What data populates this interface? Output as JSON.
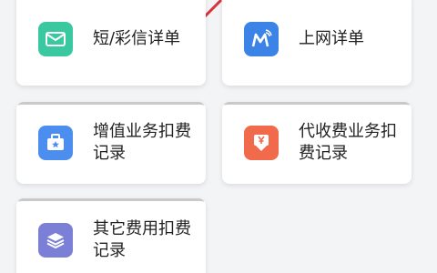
{
  "colors": {
    "sms_icon_bg": "#39c8a0",
    "data_icon_bg": "#3b83e6",
    "vas_icon_bg": "#4b8ef0",
    "proxy_icon_bg": "#f06a4b",
    "other_icon_bg": "#7b7fd6",
    "accent_stroke": "#d9323a"
  },
  "cards": [
    {
      "label": "短/彩信详单",
      "icon": "envelope-icon"
    },
    {
      "label": "上网详单",
      "icon": "signal-m-icon"
    },
    {
      "label": "增值业务扣费记录",
      "icon": "briefcase-star-icon"
    },
    {
      "label": "代收费业务扣费记录",
      "icon": "yuan-download-icon"
    },
    {
      "label": "其它费用扣费记录",
      "icon": "layers-icon"
    }
  ]
}
